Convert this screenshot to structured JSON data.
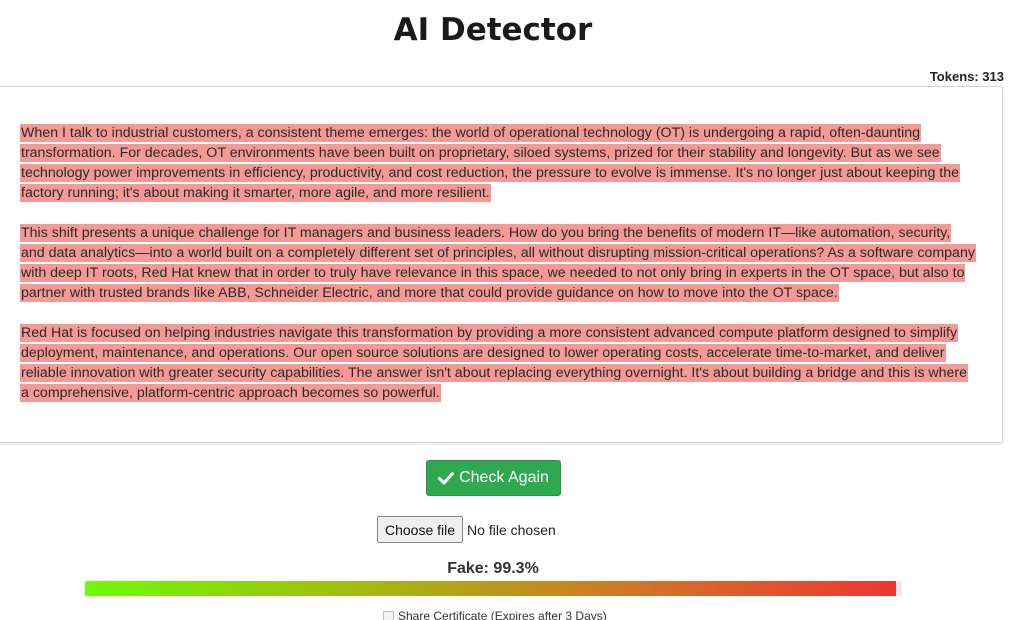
{
  "title": "AI Detector",
  "tokens_label": "Tokens: 313",
  "paragraphs": [
    "When I talk to industrial customers, a consistent theme emerges: the world of operational technology (OT) is undergoing a rapid, often-daunting transformation. For decades, OT environments have been built on proprietary, siloed systems, prized for their stability and longevity. But as we see technology power improvements in efficiency, productivity, and cost reduction, the pressure to evolve is immense. It's no longer just about keeping the factory running; it's about making it smarter, more agile, and more resilient.",
    "This shift presents a unique challenge for IT managers and business leaders. How do you bring the benefits of modern IT—like automation, security, and data analytics—into a world built on a completely different set of principles, all without disrupting mission-critical operations? As a software company with deep IT roots, Red Hat knew that in order to truly have relevance in this space, we needed to not only bring in experts in the OT space, but also to partner with trusted brands like ABB, Schneider Electric, and more that could provide guidance on how to move into the OT space.",
    "Red Hat is focused on helping industries navigate this transformation by providing a more consistent advanced compute platform designed to simplify deployment, maintenance, and operations. Our open source solutions are designed to lower operating costs, accelerate time-to-market, and deliver reliable innovation with greater security capabilities. The answer isn't about replacing everything overnight. It's about building a bridge and this is where a comprehensive, platform-centric approach becomes so powerful."
  ],
  "check_button": {
    "label": "Check Again",
    "icon": "check-icon"
  },
  "file_input": {
    "button_label": "Choose file",
    "status": "No file chosen"
  },
  "result": {
    "label": "Fake: 99.3%",
    "fake_fraction": 0.993
  },
  "share": {
    "label": "Share Certificate (Expires after 3 Days)"
  },
  "colors": {
    "highlight": "#f49a96",
    "button": "#2fa84f",
    "bar_start": "#6dfa04",
    "bar_end": "#ee3434"
  }
}
